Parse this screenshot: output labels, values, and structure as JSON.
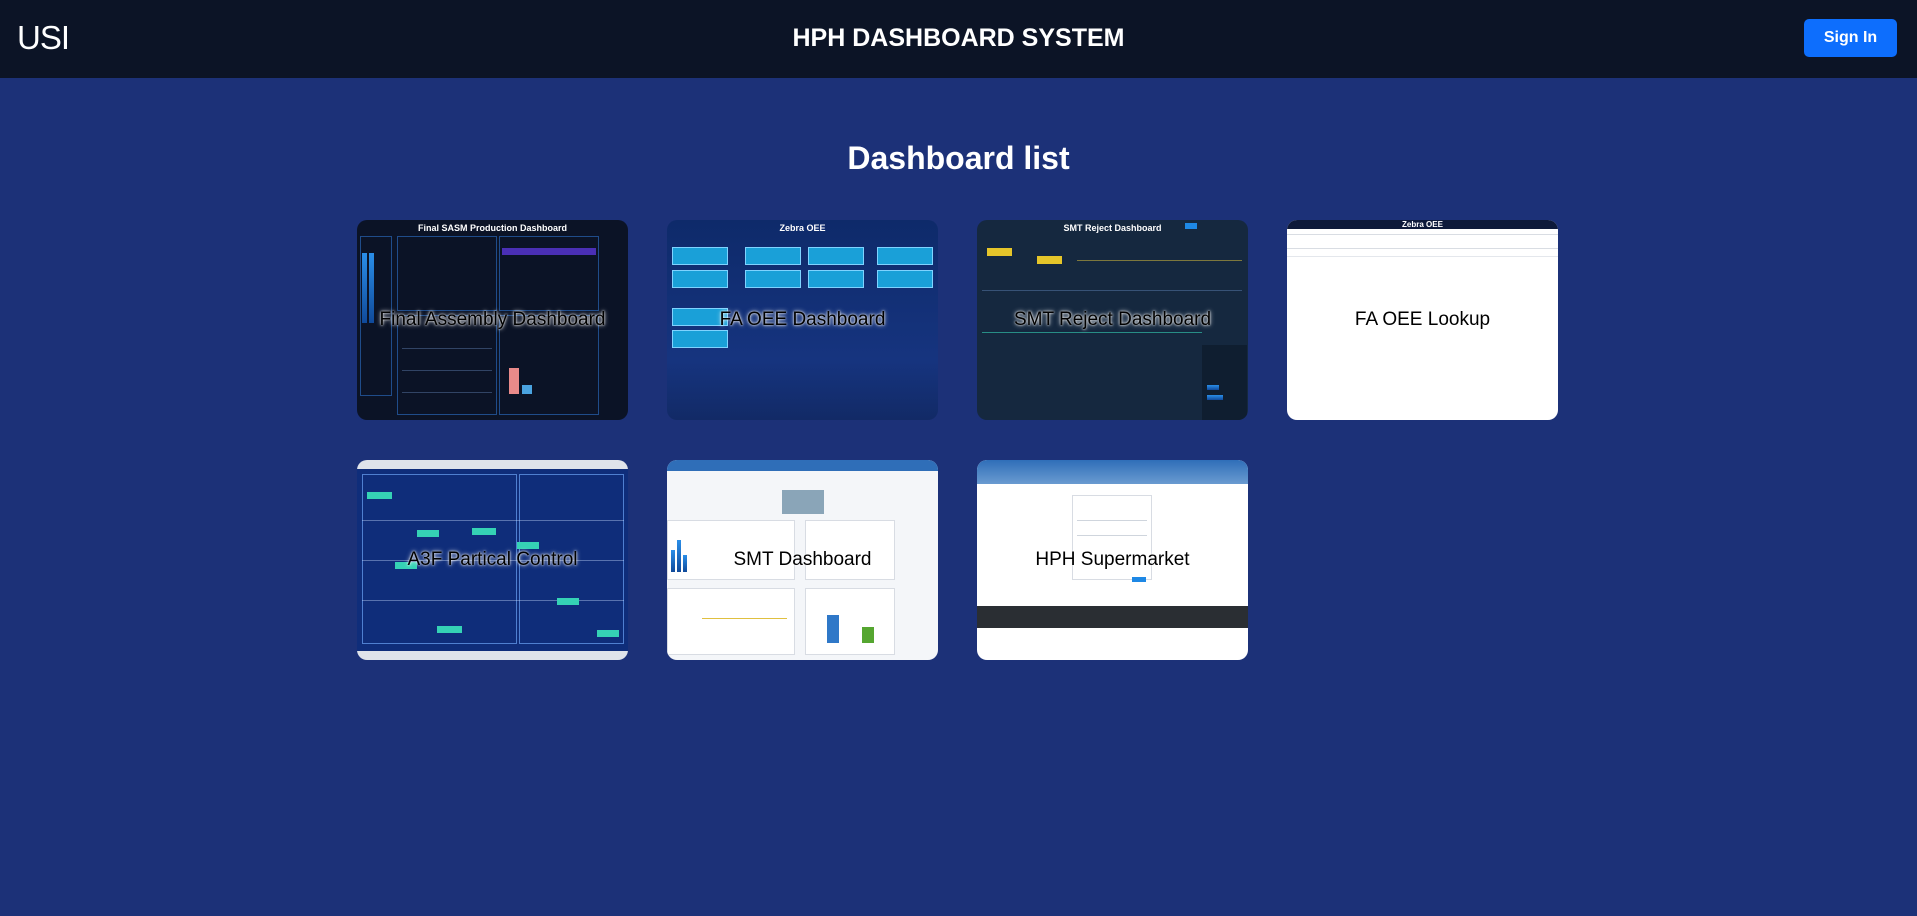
{
  "header": {
    "logo": "USI",
    "title": "HPH DASHBOARD SYSTEM",
    "signin_label": "Sign In"
  },
  "page": {
    "heading": "Dashboard list"
  },
  "dashboards": [
    {
      "label": "Final Assembly Dashboard",
      "thumb_title": "Final SASM Production Dashboard"
    },
    {
      "label": "FA OEE Dashboard",
      "thumb_title": "Zebra OEE"
    },
    {
      "label": "SMT Reject Dashboard",
      "thumb_title": "SMT Reject Dashboard"
    },
    {
      "label": "FA OEE Lookup",
      "thumb_title": "Zebra OEE"
    },
    {
      "label": "A3F Partical Control"
    },
    {
      "label": "SMT Dashboard"
    },
    {
      "label": "HPH Supermarket"
    }
  ],
  "colors": {
    "page_bg": "#1c3178",
    "header_bg": "#0c1426",
    "accent": "#0d6efd"
  }
}
